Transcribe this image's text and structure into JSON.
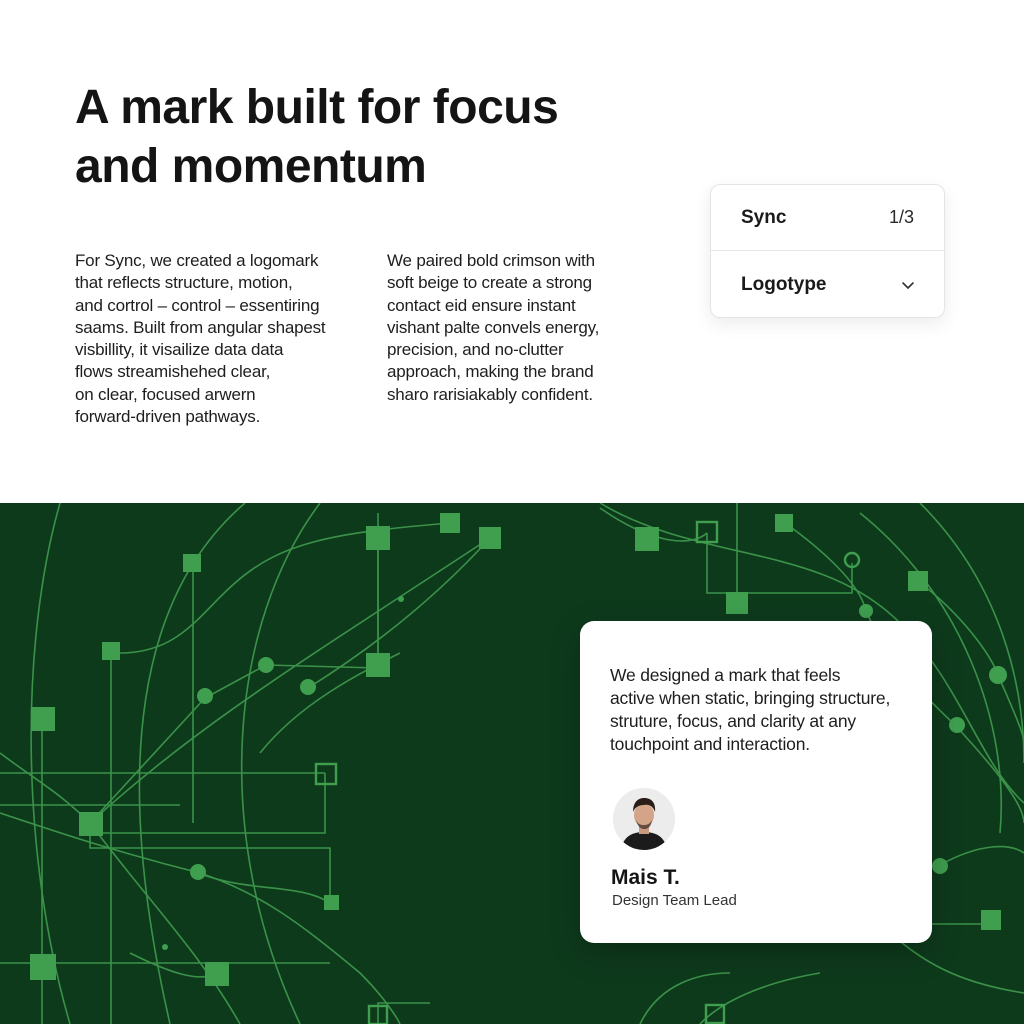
{
  "headline": {
    "lines": [
      "A mark built for focus",
      "and momentum"
    ]
  },
  "intro": {
    "left_lines": [
      "For Sync, we created a logomark",
      "that reflects structure, motion,",
      "and cortrol – control – essentiring",
      "saams. Built from angular shapest",
      "visbillity, it visailize  data data",
      "flows streamishehed clear,",
      "on clear, focused arwern",
      "forward-driven pathways."
    ],
    "right_lines": [
      "We paired bold crimson with",
      "soft beige to create a strong",
      "contact eid ensure instant",
      "vishant palte convels energy,",
      "precision, and no-clutter",
      "approach, making the brand",
      "sharo rarisiakably confident."
    ]
  },
  "selector": {
    "brand_label": "Sync",
    "counter": "1/3",
    "asset_label": "Logotype",
    "chevron_icon": "chevron-down-icon"
  },
  "testimonial": {
    "quote_lines": [
      "We designed a mark that feels",
      "active when static, bringing structure,",
      "struture, focus, and clarity at any",
      "touchpoint and interaction."
    ],
    "author_name": "Mais T.",
    "author_role": "Design Team Lead",
    "avatar_icon": "avatar-photo"
  },
  "colors": {
    "background": "#ffffff",
    "green_panel": "#0e3a1c",
    "network_line": "#3f9c4e",
    "network_node": "#3f9f4f",
    "text": "#141414"
  }
}
